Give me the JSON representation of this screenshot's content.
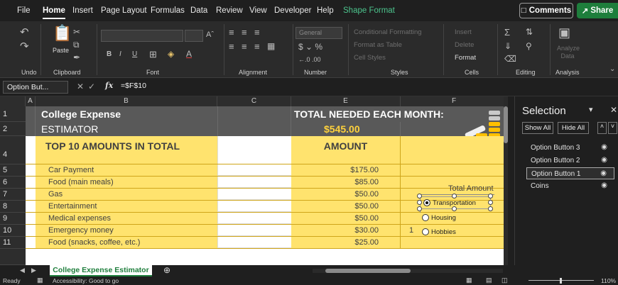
{
  "menu": {
    "tabs": [
      "File",
      "Home",
      "Insert",
      "Page Layout",
      "Formulas",
      "Data",
      "Review",
      "View",
      "Developer",
      "Help"
    ],
    "contextual_tab": "Shape Format",
    "comments_label": "Comments",
    "share_label": "Share"
  },
  "ribbon": {
    "groups": [
      "Undo",
      "Clipboard",
      "Font",
      "Alignment",
      "Number",
      "Styles",
      "Cells",
      "Editing",
      "Analysis"
    ],
    "paste_label": "Paste",
    "number_format": "General",
    "styles_items": [
      "Conditional Formatting",
      "Format as Table",
      "Cell Styles"
    ],
    "cells_items": [
      "Insert",
      "Delete",
      "Format"
    ],
    "analyze_label": "Analyze Data",
    "font_buttons": [
      "B",
      "I",
      "U"
    ]
  },
  "formula_bar": {
    "name_box": "Option But...",
    "formula": "=$F$10"
  },
  "columns": [
    "A",
    "B",
    "C",
    "E",
    "F"
  ],
  "rows": [
    {
      "num": "1",
      "b": "College Expense",
      "e": "TOTAL NEEDED EACH MONTH:"
    },
    {
      "num": "2",
      "b": "ESTIMATOR",
      "e": "$545.00"
    },
    {
      "num": "4",
      "b": "TOP 10 AMOUNTS IN TOTAL",
      "e": "AMOUNT"
    },
    {
      "num": "5",
      "b": "Car Payment",
      "e": "$175.00"
    },
    {
      "num": "6",
      "b": "Food (main meals)",
      "e": "$85.00"
    },
    {
      "num": "7",
      "b": "Gas",
      "e": "$50.00"
    },
    {
      "num": "8",
      "b": "Entertainment",
      "e": "$50.00"
    },
    {
      "num": "9",
      "b": "Medical expenses",
      "e": "$50.00"
    },
    {
      "num": "10",
      "b": "Emergency money",
      "e": "$30.00",
      "f": "1"
    },
    {
      "num": "11",
      "b": "Food (snacks, coffee, etc.)",
      "e": "$25.00"
    }
  ],
  "group_box": {
    "label": "Total Amount",
    "options": [
      "Transportation",
      "Housing",
      "Hobbies"
    ],
    "selected": "Transportation"
  },
  "selection_pane": {
    "title": "Selection",
    "show_all": "Show All",
    "hide_all": "Hide All",
    "items": [
      "Option Button 3",
      "Option Button 2",
      "Option Button 1",
      "Coins"
    ],
    "selected_item": "Option Button 1"
  },
  "sheet_tab": "College Expense Estimator",
  "status": {
    "ready": "Ready",
    "accessibility": "Accessibility: Good to go",
    "zoom": "110%"
  },
  "colors": {
    "yellow": "#ffe36e",
    "header_gray": "#595959",
    "gold_text": "#ffd23c",
    "accent_green": "#1e7e3c"
  }
}
